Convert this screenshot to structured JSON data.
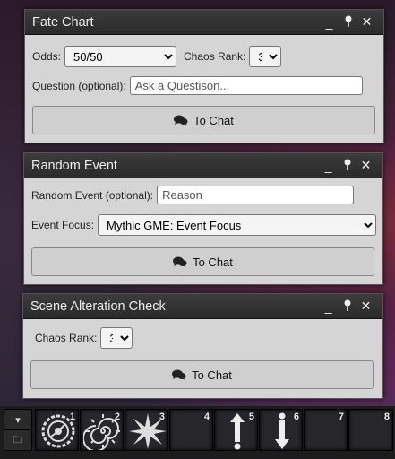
{
  "fate_chart": {
    "title": "Fate Chart",
    "odds_label": "Odds:",
    "odds_value": "50/50",
    "chaos_label": "Chaos Rank:",
    "chaos_value": "3",
    "question_label": "Question (optional):",
    "question_placeholder": "Ask a Questison...",
    "button_label": "To Chat"
  },
  "random_event": {
    "title": "Random Event",
    "event_label": "Random Event (optional):",
    "event_placeholder": "Reason",
    "focus_label": "Event Focus:",
    "focus_value": "Mythic GME: Event Focus",
    "button_label": "To Chat"
  },
  "scene_check": {
    "title": "Scene Alteration Check",
    "chaos_label": "Chaos Rank:",
    "chaos_value": "3",
    "button_label": "To Chat"
  },
  "window_controls": {
    "minimize": "_",
    "pin": "📍",
    "close": "✕"
  },
  "hotbar": {
    "controls": [
      {
        "icon": "caret-down-icon",
        "glyph": "▾"
      },
      {
        "icon": "folder-icon",
        "glyph": "🗀"
      }
    ],
    "slots": [
      {
        "number": "1",
        "icon": "clockwork-dial-icon"
      },
      {
        "number": "2",
        "icon": "spiral-icon"
      },
      {
        "number": "3",
        "icon": "burst-icon"
      },
      {
        "number": "4",
        "icon": ""
      },
      {
        "number": "5",
        "icon": "up-arrow-icon"
      },
      {
        "number": "6",
        "icon": "down-arrow-icon"
      },
      {
        "number": "7",
        "icon": ""
      },
      {
        "number": "8",
        "icon": ""
      }
    ]
  }
}
